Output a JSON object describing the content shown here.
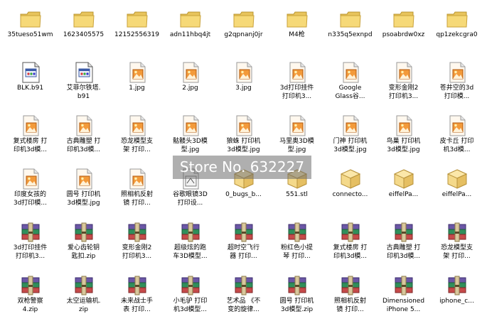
{
  "items": [
    {
      "label": "35tueso51wm",
      "icon": "folder-icon"
    },
    {
      "label": "1623405575",
      "icon": "folder-icon"
    },
    {
      "label": "12152556319",
      "icon": "folder-icon"
    },
    {
      "label": "adn11hbq4jt",
      "icon": "folder-icon"
    },
    {
      "label": "g2qpnanj0jr",
      "icon": "folder-icon"
    },
    {
      "label": "M4枪",
      "icon": "folder-icon"
    },
    {
      "label": "n335q5exnpd",
      "icon": "folder-icon"
    },
    {
      "label": "psoabrdw0xz",
      "icon": "folder-icon"
    },
    {
      "label": "qp1zekcgra0",
      "icon": "folder-icon"
    },
    {
      "label": "BLK.b91",
      "icon": "application-file-icon"
    },
    {
      "label": "艾菲尔铁塔.\nb91",
      "icon": "application-file-icon"
    },
    {
      "label": "1.jpg",
      "icon": "image-file-icon"
    },
    {
      "label": "2.jpg",
      "icon": "image-file-icon"
    },
    {
      "label": "3.jpg",
      "icon": "image-file-icon"
    },
    {
      "label": "3d打印挂件\n打印机3...",
      "icon": "image-file-icon"
    },
    {
      "label": "Google\nGlass谷...",
      "icon": "image-file-icon"
    },
    {
      "label": "变形金刚2\n打印机3...",
      "icon": "image-file-icon"
    },
    {
      "label": "苍井空的3d\n打印模...",
      "icon": "image-file-icon"
    },
    {
      "label": "复式楼房 打\n印机3d模...",
      "icon": "image-file-icon"
    },
    {
      "label": "古典雕塑 打\n印机3d模...",
      "icon": "image-file-icon"
    },
    {
      "label": "恐龙模型支\n架 打印...",
      "icon": "image-file-icon"
    },
    {
      "label": "骷髅头3D模\n型.jpg",
      "icon": "image-file-icon"
    },
    {
      "label": "狼蛛 打印机\n3d模型.jpg",
      "icon": "image-file-icon"
    },
    {
      "label": "马里奥3D模\n型.jpg",
      "icon": "image-file-icon"
    },
    {
      "label": "门神 打印机\n3d模型.jpg",
      "icon": "image-file-icon"
    },
    {
      "label": "鸟巢 打印机\n3d模型.jpg",
      "icon": "image-file-icon"
    },
    {
      "label": "皮卡丘 打印\n机3d模...",
      "icon": "image-file-icon"
    },
    {
      "label": "印度女孩的\n3d打印模...",
      "icon": "image-file-icon"
    },
    {
      "label": "圆号 打印机\n3d模型.jpg",
      "icon": "image-file-icon"
    },
    {
      "label": "照相机反射\n镜 打印...",
      "icon": "image-file-icon"
    },
    {
      "label": "谷歌眼镜3D\n打印设...",
      "icon": "stl-file-icon"
    },
    {
      "label": "0_bugs_b...",
      "icon": "box-file-icon"
    },
    {
      "label": "551.stl",
      "icon": "box-file-icon"
    },
    {
      "label": "connecto...",
      "icon": "box-file-icon"
    },
    {
      "label": "eiffelPa...",
      "icon": "box-file-icon"
    },
    {
      "label": "eiffelPa...",
      "icon": "box-file-icon"
    },
    {
      "label": "3d打印挂件\n打印机3...",
      "icon": "rar-archive-icon"
    },
    {
      "label": "爱心齿轮钥\n匙扣.zip",
      "icon": "rar-archive-icon"
    },
    {
      "label": "变形金刚2\n打印机3...",
      "icon": "rar-archive-icon"
    },
    {
      "label": "超级炫的跑\n车3D模型...",
      "icon": "rar-archive-icon"
    },
    {
      "label": "超时空飞行\n器 打印...",
      "icon": "rar-archive-icon"
    },
    {
      "label": "粉红色小提\n琴 打印...",
      "icon": "rar-archive-icon"
    },
    {
      "label": "复式楼房 打\n印机3d模...",
      "icon": "rar-archive-icon"
    },
    {
      "label": "古典雕塑 打\n印机3d模...",
      "icon": "rar-archive-icon"
    },
    {
      "label": "恐龙模型支\n架 打印...",
      "icon": "rar-archive-icon"
    },
    {
      "label": "双枪警察\n4.zip",
      "icon": "rar-archive-icon"
    },
    {
      "label": "太空运输机.\nzip",
      "icon": "rar-archive-icon"
    },
    {
      "label": "未来战士手\n表 打印...",
      "icon": "rar-archive-icon"
    },
    {
      "label": "小毛驴 打印\n机3d模型...",
      "icon": "rar-archive-icon"
    },
    {
      "label": "艺术品 《不\n变的旋律...",
      "icon": "rar-archive-icon"
    },
    {
      "label": "圆号 打印机\n3d模型.zip",
      "icon": "rar-archive-icon"
    },
    {
      "label": "照相机反射\n镜 打印...",
      "icon": "rar-archive-icon"
    },
    {
      "label": "Dimensioned\niPhone 5...",
      "icon": "rar-archive-icon"
    },
    {
      "label": "iphone_c...",
      "icon": "rar-archive-icon"
    }
  ],
  "watermark": {
    "text": "Store No. 632227"
  },
  "colors": {
    "folder": "#f3d36b",
    "box": "#e9c771",
    "rar_purple": "#6b57a6",
    "selection": "#316ac5"
  }
}
